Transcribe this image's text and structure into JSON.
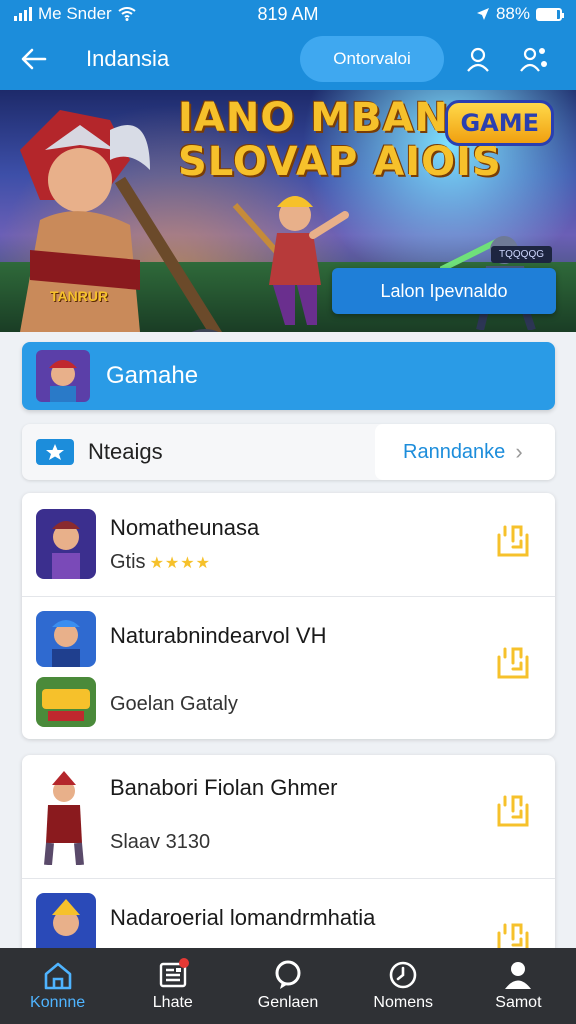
{
  "status_bar": {
    "carrier": "Me Snder",
    "time": "819 AM",
    "battery": "88%",
    "battery_level": 0.88
  },
  "app_bar": {
    "back_icon": "arrow-left-icon",
    "title": "Indansia",
    "pill_button": "Ontorvaloi",
    "actions": [
      "user-icon",
      "people-icon"
    ]
  },
  "banner": {
    "title_line1": "IANO MBAN",
    "title_line2": "SLOVAP AIOIS",
    "badge": "GAME",
    "corner_tag": "TQQQQG",
    "logo_text": "TANRUR",
    "cta": "Lalon Ipevnaldo"
  },
  "category": {
    "label": "Gamahe"
  },
  "rankings": {
    "icon": "star-icon",
    "label": "Nteaigs",
    "link": "Ranndanke",
    "chevron": "›"
  },
  "list_groups": [
    {
      "items": [
        {
          "title": "Nomatheunasa",
          "subtitle": "Gtis",
          "stars": "★★★★",
          "action_icon": "controller-icon"
        },
        {
          "title": "Naturabnindearvol VH",
          "action_icon": "controller-icon"
        },
        {
          "title": "",
          "subtitle": "Goelan Gataly"
        }
      ]
    },
    {
      "items": [
        {
          "title": "Banabori Fiolan Ghmer",
          "subtitle": "Slaav 3130",
          "action_icon": "controller-icon"
        },
        {
          "title": "Nadaroerial lomandrmhatia",
          "action_icon": "controller-icon"
        }
      ]
    }
  ],
  "bottom_nav": [
    {
      "label": "Konnne",
      "icon": "home-icon",
      "active": true
    },
    {
      "label": "Lhate",
      "icon": "news-icon",
      "badge": true
    },
    {
      "label": "Genlaen",
      "icon": "chat-icon"
    },
    {
      "label": "Nomens",
      "icon": "clock-icon"
    },
    {
      "label": "Samot",
      "icon": "profile-icon"
    }
  ],
  "colors": {
    "primary": "#1c8ddb",
    "accent_yellow": "#f6c12b",
    "nav_bg": "#2f3135",
    "active_nav": "#4fb4ff"
  }
}
